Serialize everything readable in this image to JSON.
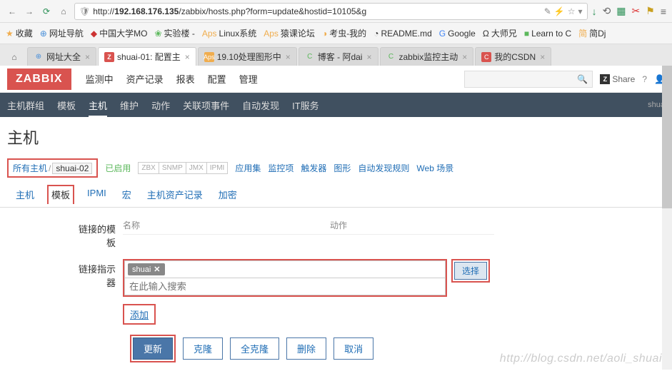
{
  "browser": {
    "url_host": "192.168.176.135",
    "url_rest": "/zabbix/hosts.php?form=update&hostid=10105&g",
    "bookmarks_label": "收藏",
    "bookmarks": [
      {
        "label": "网址导航"
      },
      {
        "label": "中国大学MO"
      },
      {
        "label": "实验楼 -"
      },
      {
        "label": "Linux系统"
      },
      {
        "label": "猿课论坛"
      },
      {
        "label": "考虫-我的"
      },
      {
        "label": "README.md"
      },
      {
        "label": "Google"
      },
      {
        "label": "大师兄"
      },
      {
        "label": "Learn to C"
      },
      {
        "label": "简Dj"
      }
    ],
    "tabs": [
      {
        "label": "网址大全"
      },
      {
        "label": "shuai-01: 配置主"
      },
      {
        "label": "19.10处理图形中"
      },
      {
        "label": "博客 - 阿dai"
      },
      {
        "label": "zabbix监控主动"
      },
      {
        "label": "我的CSDN"
      }
    ]
  },
  "zabbix": {
    "logo": "ZABBIX",
    "main_nav": [
      "监测中",
      "资产记录",
      "报表",
      "配置",
      "管理"
    ],
    "main_nav_active": "配置",
    "share": "Share",
    "sub_nav": [
      "主机群组",
      "模板",
      "主机",
      "维护",
      "动作",
      "关联项事件",
      "自动发现",
      "IT服务"
    ],
    "sub_nav_active": "主机",
    "sub_nav_right": "shua",
    "page_title": "主机",
    "breadcrumb": {
      "all": "所有主机",
      "current": "shuai-02"
    },
    "enabled": "已启用",
    "protocols": [
      "ZBX",
      "SNMP",
      "JMX",
      "IPMI"
    ],
    "host_links": [
      "应用集",
      "监控项",
      "触发器",
      "图形",
      "自动发现规则",
      "Web 场景"
    ],
    "host_tabs": [
      "主机",
      "模板",
      "IPMI",
      "宏",
      "主机资产记录",
      "加密"
    ],
    "host_tab_active": "模板",
    "form": {
      "linked_label": "链接的模板",
      "col_name": "名称",
      "col_action": "动作",
      "linker_label": "链接指示器",
      "chip": "shuai",
      "placeholder": "在此输入搜索",
      "select_btn": "选择",
      "add_link": "添加"
    },
    "buttons": {
      "update": "更新",
      "clone": "克隆",
      "full_clone": "全克隆",
      "delete": "删除",
      "cancel": "取消"
    }
  },
  "watermark": "http://blog.csdn.net/aoli_shuai"
}
